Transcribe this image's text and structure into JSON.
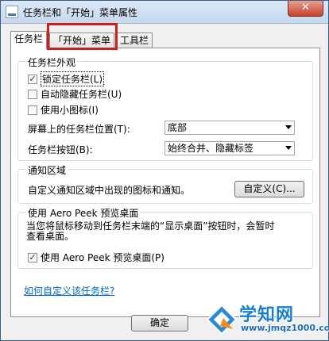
{
  "window": {
    "title": "任务栏和「开始」菜单属性",
    "close_glyph": "✕"
  },
  "tabs": [
    {
      "label": "任务栏"
    },
    {
      "label": "「开始」菜单"
    },
    {
      "label": "工具栏"
    }
  ],
  "appearance": {
    "title": "任务栏外观",
    "lock_taskbar": {
      "label": "锁定任务栏(L)",
      "checked": true
    },
    "auto_hide": {
      "label": "自动隐藏任务栏(U)",
      "checked": false
    },
    "small_icons": {
      "label": "使用小图标(I)",
      "checked": false
    },
    "position_label": "屏幕上的任务栏位置(T):",
    "position_value": "底部",
    "buttons_label": "任务栏按钮(B):",
    "buttons_value": "始终合并、隐藏标签"
  },
  "notification": {
    "title": "通知区域",
    "text": "自定义通知区域中出现的图标和通知。",
    "customize_button": "自定义(C)..."
  },
  "aero_peek": {
    "title": "使用 Aero Peek 预览桌面",
    "desc_line1": "当您将鼠标移动到任务栏末端的“显示桌面”按钮时，会暂时",
    "desc_line2": "查看桌面。",
    "use_peek": {
      "label": "使用 Aero Peek 预览桌面(P)",
      "checked": true
    }
  },
  "help_link": "如何自定义该任务栏?",
  "buttons": {
    "ok": "确定"
  },
  "watermark": {
    "name": "学知网",
    "url": "www.jmqz1000.com"
  },
  "colors": {
    "highlight": "#cc1f1f",
    "link": "#0066cc"
  }
}
